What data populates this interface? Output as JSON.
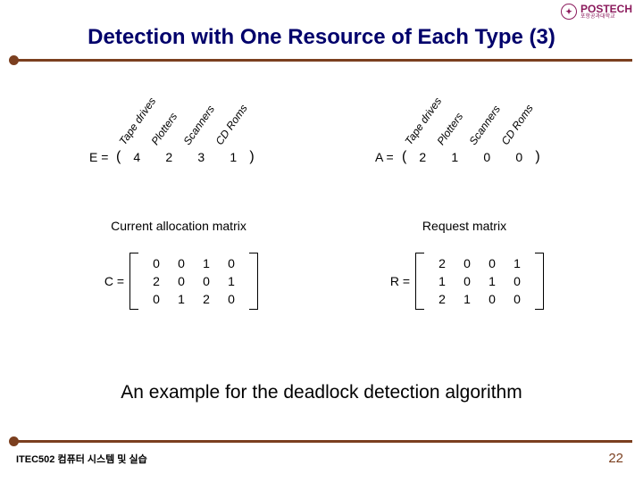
{
  "logo": {
    "name": "POSTECH",
    "sub": "포항공과대학교"
  },
  "title": "Detection with One Resource of Each Type (3)",
  "columns": [
    "Tape drives",
    "Plotters",
    "Scanners",
    "CD Roms"
  ],
  "vectors": {
    "E": {
      "name": "E =",
      "values": [
        "4",
        "2",
        "3",
        "1"
      ]
    },
    "A": {
      "name": "A =",
      "values": [
        "2",
        "1",
        "0",
        "0"
      ]
    }
  },
  "matrices": {
    "C": {
      "label": "Current allocation matrix",
      "name": "C =",
      "rows": [
        [
          "0",
          "0",
          "1",
          "0"
        ],
        [
          "2",
          "0",
          "0",
          "1"
        ],
        [
          "0",
          "1",
          "2",
          "0"
        ]
      ]
    },
    "R": {
      "label": "Request matrix",
      "name": "R =",
      "rows": [
        [
          "2",
          "0",
          "0",
          "1"
        ],
        [
          "1",
          "0",
          "1",
          "0"
        ],
        [
          "2",
          "1",
          "0",
          "0"
        ]
      ]
    }
  },
  "caption": "An example for the deadlock detection algorithm",
  "footer": {
    "left": "ITEC502 컴퓨터 시스템 및 실습",
    "page": "22"
  },
  "chart_data": {
    "type": "table",
    "resources": [
      "Tape drives",
      "Plotters",
      "Scanners",
      "CD Roms"
    ],
    "existing_E": [
      4,
      2,
      3,
      1
    ],
    "available_A": [
      2,
      1,
      0,
      0
    ],
    "allocation_C": [
      [
        0,
        0,
        1,
        0
      ],
      [
        2,
        0,
        0,
        1
      ],
      [
        0,
        1,
        2,
        0
      ]
    ],
    "request_R": [
      [
        2,
        0,
        0,
        1
      ],
      [
        1,
        0,
        1,
        0
      ],
      [
        2,
        1,
        0,
        0
      ]
    ]
  }
}
